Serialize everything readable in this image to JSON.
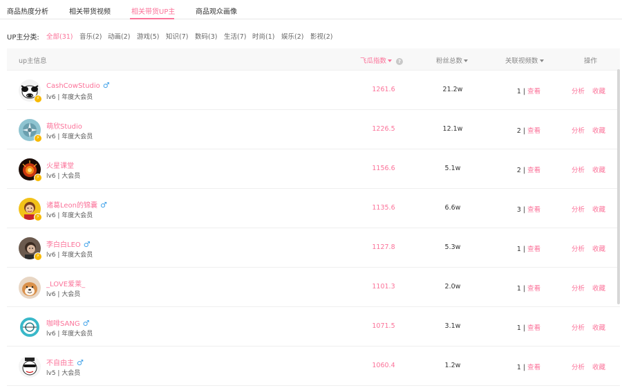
{
  "tabs": [
    {
      "label": "商品热度分析"
    },
    {
      "label": "相关带货视频"
    },
    {
      "label": "相关带货UP主"
    },
    {
      "label": "商品观众画像"
    }
  ],
  "active_tab": "相关带货UP主",
  "filter": {
    "label": "UP主分类:",
    "chips": [
      {
        "label": "全部(31)"
      },
      {
        "label": "音乐(2)"
      },
      {
        "label": "动画(2)"
      },
      {
        "label": "游戏(5)"
      },
      {
        "label": "知识(7)"
      },
      {
        "label": "数码(3)"
      },
      {
        "label": "生活(7)"
      },
      {
        "label": "时尚(1)"
      },
      {
        "label": "娱乐(2)"
      },
      {
        "label": "影视(2)"
      }
    ],
    "active": "全部(31)"
  },
  "table": {
    "headers": {
      "info": "up主信息",
      "score": "飞瓜指数",
      "fans": "粉丝总数",
      "videos": "关联视频数",
      "ops": "操作"
    },
    "view_label": "查看",
    "analyze_label": "分析",
    "collect_label": "收藏",
    "separator": "|",
    "rows": [
      {
        "name": "CashCowStudio",
        "gender": "♂",
        "level": "lv6 | 年度大会员",
        "score": "1261.6",
        "fans": "21.2w",
        "videos": "1",
        "avatar": "cow-avatar",
        "verified": true
      },
      {
        "name": "萌欣Studio",
        "gender": "",
        "level": "lv6 | 年度大会员",
        "score": "1226.5",
        "fans": "12.1w",
        "videos": "2",
        "avatar": "logo-avatar",
        "verified": true
      },
      {
        "name": "火星课堂",
        "gender": "",
        "level": "lv6 | 大会员",
        "score": "1156.6",
        "fans": "5.1w",
        "videos": "2",
        "avatar": "fire-avatar",
        "verified": true
      },
      {
        "name": "诸葛Leon的锦囊",
        "gender": "♂",
        "level": "lv6 | 年度大会员",
        "score": "1135.6",
        "fans": "6.6w",
        "videos": "3",
        "avatar": "person-avatar",
        "verified": true
      },
      {
        "name": "李白白LEO",
        "gender": "♂",
        "level": "lv6 | 年度大会员",
        "score": "1127.8",
        "fans": "5.3w",
        "videos": "1",
        "avatar": "portrait-avatar",
        "verified": true
      },
      {
        "name": "_LOVE爱莱_",
        "gender": "",
        "level": "lv6 | 大会员",
        "score": "1101.3",
        "fans": "2.0w",
        "videos": "1",
        "avatar": "dog-avatar",
        "verified": false
      },
      {
        "name": "咖啡SANG",
        "gender": "♂",
        "level": "lv6 | 年度大会员",
        "score": "1071.5",
        "fans": "3.1w",
        "videos": "1",
        "avatar": "circle-logo-avatar",
        "verified": false
      },
      {
        "name": "不自由主",
        "gender": "♂",
        "level": "lv5 | 大会员",
        "score": "1060.4",
        "fans": "1.2w",
        "videos": "1",
        "avatar": "cartoon-avatar",
        "verified": false
      }
    ]
  },
  "colors": {
    "accent": "#fb7299",
    "male": "#3fa1e8",
    "verify": "#f7b900"
  }
}
